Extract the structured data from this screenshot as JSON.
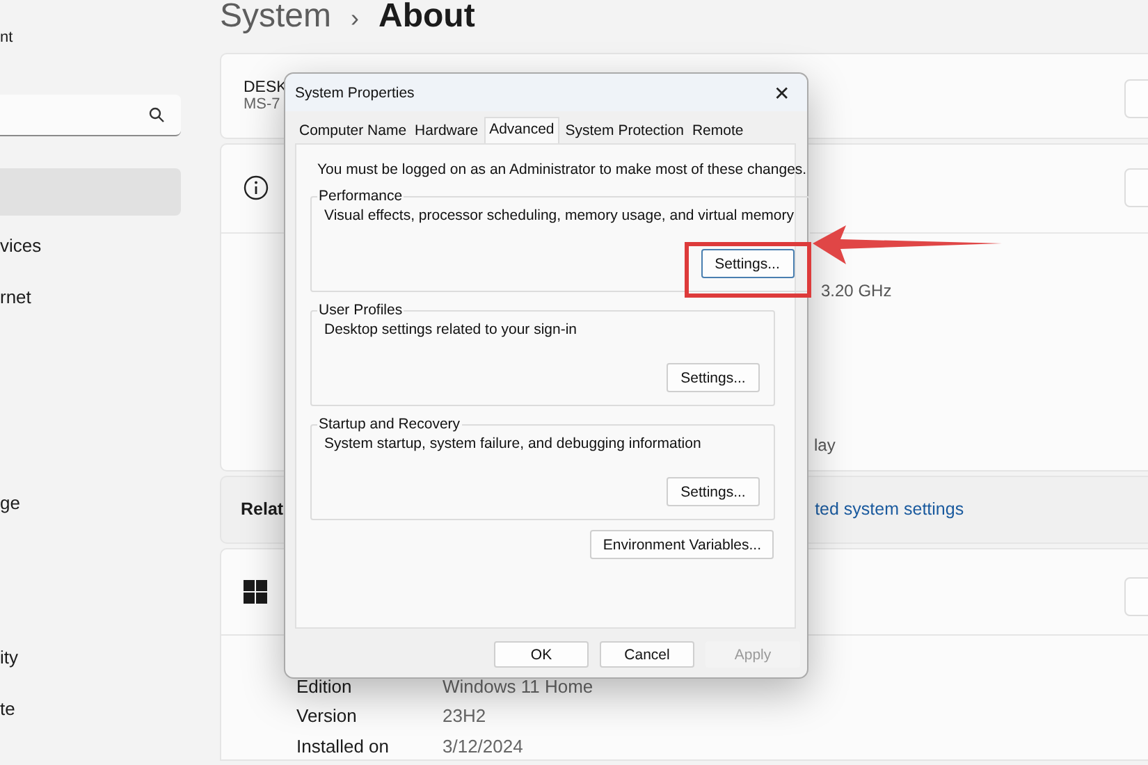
{
  "settings": {
    "breadcrumb": {
      "parent": "System",
      "separator": "›",
      "current": "About"
    },
    "nav": {
      "account": "nt",
      "items": [
        {
          "selected": true
        },
        {
          "label": "vices",
          "selected": false
        },
        {
          "label": "rnet",
          "selected": false
        },
        {
          "label": "ge",
          "selected": false
        },
        {
          "label": "ity",
          "selected": false
        },
        {
          "label": "te",
          "selected": false
        }
      ]
    },
    "device": {
      "name": "DESK",
      "model": "MS-7"
    },
    "specs": {
      "speed": "3.20 GHz",
      "display": "lay"
    },
    "related": {
      "title": "Relat",
      "link": "ted system settings"
    },
    "windows_specs": [
      {
        "label": "Edition",
        "value": "Windows 11 Home"
      },
      {
        "label": "Version",
        "value": "23H2"
      },
      {
        "label": "Installed on",
        "value": "3/12/2024"
      }
    ]
  },
  "dialog": {
    "title": "System Properties",
    "close": "✕",
    "tabs": [
      {
        "label": "Computer Name",
        "selected": false
      },
      {
        "label": "Hardware",
        "selected": false
      },
      {
        "label": "Advanced",
        "selected": true
      },
      {
        "label": "System Protection",
        "selected": false
      },
      {
        "label": "Remote",
        "selected": false
      }
    ],
    "notice": "You must be logged on as an Administrator to make most of these changes.",
    "groups": [
      {
        "title": "Performance",
        "description": "Visual effects, processor scheduling, memory usage, and virtual memory",
        "button": "Settings...",
        "highlighted": true
      },
      {
        "title": "User Profiles",
        "description": "Desktop settings related to your sign-in",
        "button": "Settings...",
        "highlighted": false
      },
      {
        "title": "Startup and Recovery",
        "description": "System startup, system failure, and debugging information",
        "button": "Settings...",
        "highlighted": false
      }
    ],
    "env_button": "Environment Variables...",
    "buttons": [
      {
        "label": "OK",
        "disabled": false
      },
      {
        "label": "Cancel",
        "disabled": false
      },
      {
        "label": "Apply",
        "disabled": true
      }
    ]
  }
}
